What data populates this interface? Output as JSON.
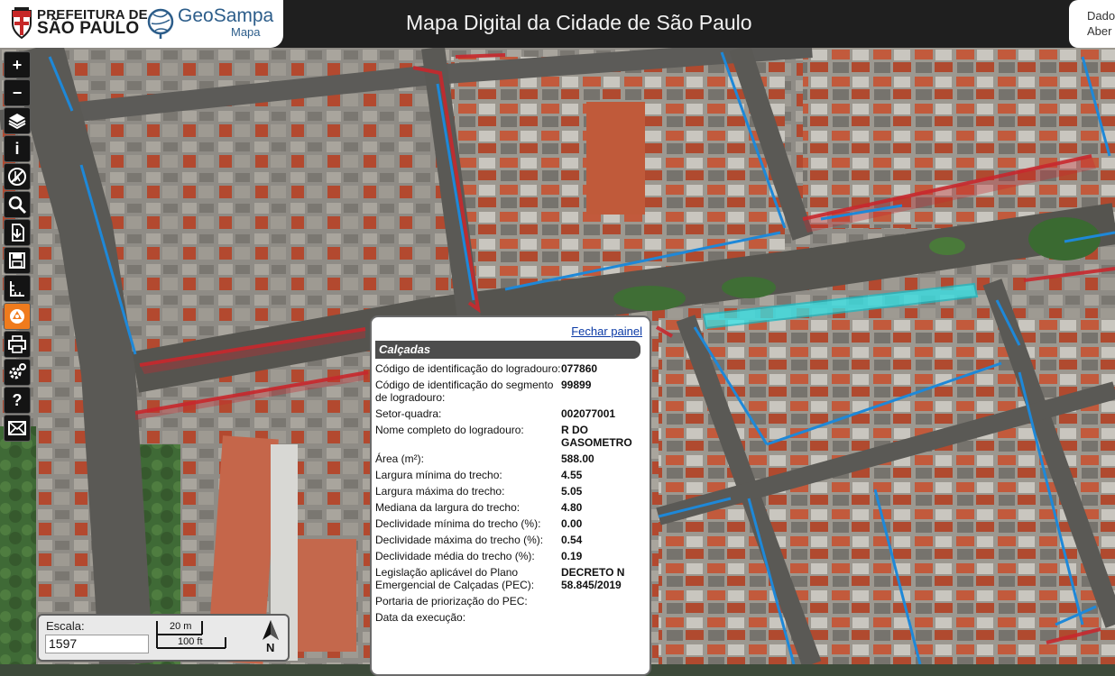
{
  "header": {
    "pmsp_line1": "PREFEITURA DE",
    "pmsp_line2": "SÃO PAULO",
    "geo_title": "GeoSampa",
    "geo_subtitle": "Mapa",
    "app_title": "Mapa Digital da Cidade de São Paulo",
    "right_line1": "Dado",
    "right_line2": "Aber"
  },
  "toolbar": {
    "tools": [
      {
        "name": "zoom-in",
        "label": "+"
      },
      {
        "name": "zoom-out",
        "label": "−"
      },
      {
        "name": "layers",
        "icon": "layers-icon"
      },
      {
        "name": "info",
        "label": "i"
      },
      {
        "name": "no-identify",
        "icon": "no-pointer-icon"
      },
      {
        "name": "search",
        "icon": "search-icon"
      },
      {
        "name": "download",
        "icon": "download-icon"
      },
      {
        "name": "save",
        "icon": "save-icon"
      },
      {
        "name": "measure",
        "icon": "ruler-icon"
      },
      {
        "name": "identify-active",
        "icon": "identify-icon",
        "active": true
      },
      {
        "name": "print",
        "icon": "printer-icon"
      },
      {
        "name": "settings",
        "icon": "gear-icon"
      },
      {
        "name": "help",
        "label": "?"
      },
      {
        "name": "contact",
        "icon": "mail-icon"
      }
    ],
    "active_color": "#f07b1d"
  },
  "panel": {
    "close_label": "Fechar painel",
    "title": "Calçadas",
    "rows": [
      {
        "label": "Código de identificação do logradouro:",
        "value": "077860"
      },
      {
        "label": "Código de identificação do segmento de logradouro:",
        "value": "99899"
      },
      {
        "label": "Setor-quadra:",
        "value": "002077001"
      },
      {
        "label": "Nome completo do logradouro:",
        "value": "R DO GASOMETRO"
      },
      {
        "label": "Área (m²):",
        "value": "588.00"
      },
      {
        "label": "Largura mínima do trecho:",
        "value": "4.55"
      },
      {
        "label": "Largura máxima do trecho:",
        "value": "5.05"
      },
      {
        "label": "Mediana da largura do trecho:",
        "value": "4.80"
      },
      {
        "label": "Declividade mínima do trecho (%):",
        "value": "0.00"
      },
      {
        "label": "Declividade máxima do trecho (%):",
        "value": "0.54"
      },
      {
        "label": "Declividade média do trecho (%):",
        "value": "0.19"
      },
      {
        "label": "Legislação aplicável do Plano Emergencial de Calçadas (PEC):",
        "value": "DECRETO N 58.845/2019"
      },
      {
        "label": "Portaria de priorização do PEC:",
        "value": ""
      },
      {
        "label": "Data da execução:",
        "value": ""
      }
    ]
  },
  "scale": {
    "label": "Escala:",
    "value": "1597",
    "metric": "20 m",
    "imperial": "100 ft",
    "north": "N"
  },
  "colors": {
    "sidewalk_red": "#c8282d",
    "sidewalk_blue": "#1e88d8",
    "selected_cyan": "#35e6ea"
  }
}
